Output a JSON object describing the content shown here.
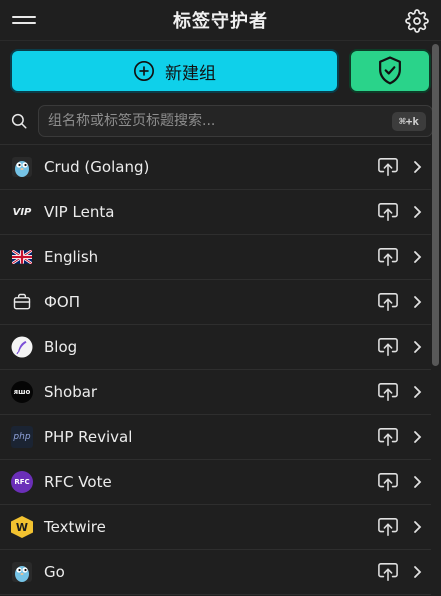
{
  "header": {
    "title": "标签守护者"
  },
  "actions": {
    "new_group_label": "新建组"
  },
  "search": {
    "placeholder": "组名称或标签页标题搜索...",
    "shortcut": "⌘+k"
  },
  "groups": [
    {
      "label": "Crud (Golang)",
      "icon": "gopher-icon"
    },
    {
      "label": "VIP Lenta",
      "icon": "vip-icon"
    },
    {
      "label": "English",
      "icon": "uk-flag-icon"
    },
    {
      "label": "ФОП",
      "icon": "briefcase-icon"
    },
    {
      "label": "Blog",
      "icon": "feather-icon"
    },
    {
      "label": "Shobar",
      "icon": "shobar-icon"
    },
    {
      "label": "PHP Revival",
      "icon": "php-icon"
    },
    {
      "label": "RFC Vote",
      "icon": "rfc-icon"
    },
    {
      "label": "Textwire",
      "icon": "textwire-icon"
    },
    {
      "label": "Go",
      "icon": "gopher-icon"
    }
  ],
  "icon_text": {
    "vip": "VIP",
    "shobar": "ᴙшо",
    "php": "php",
    "rfc": "RFC",
    "textwire": "W"
  },
  "colors": {
    "primary": "#0fd0ea",
    "success": "#2ad38a",
    "background": "#1f1f1f"
  }
}
